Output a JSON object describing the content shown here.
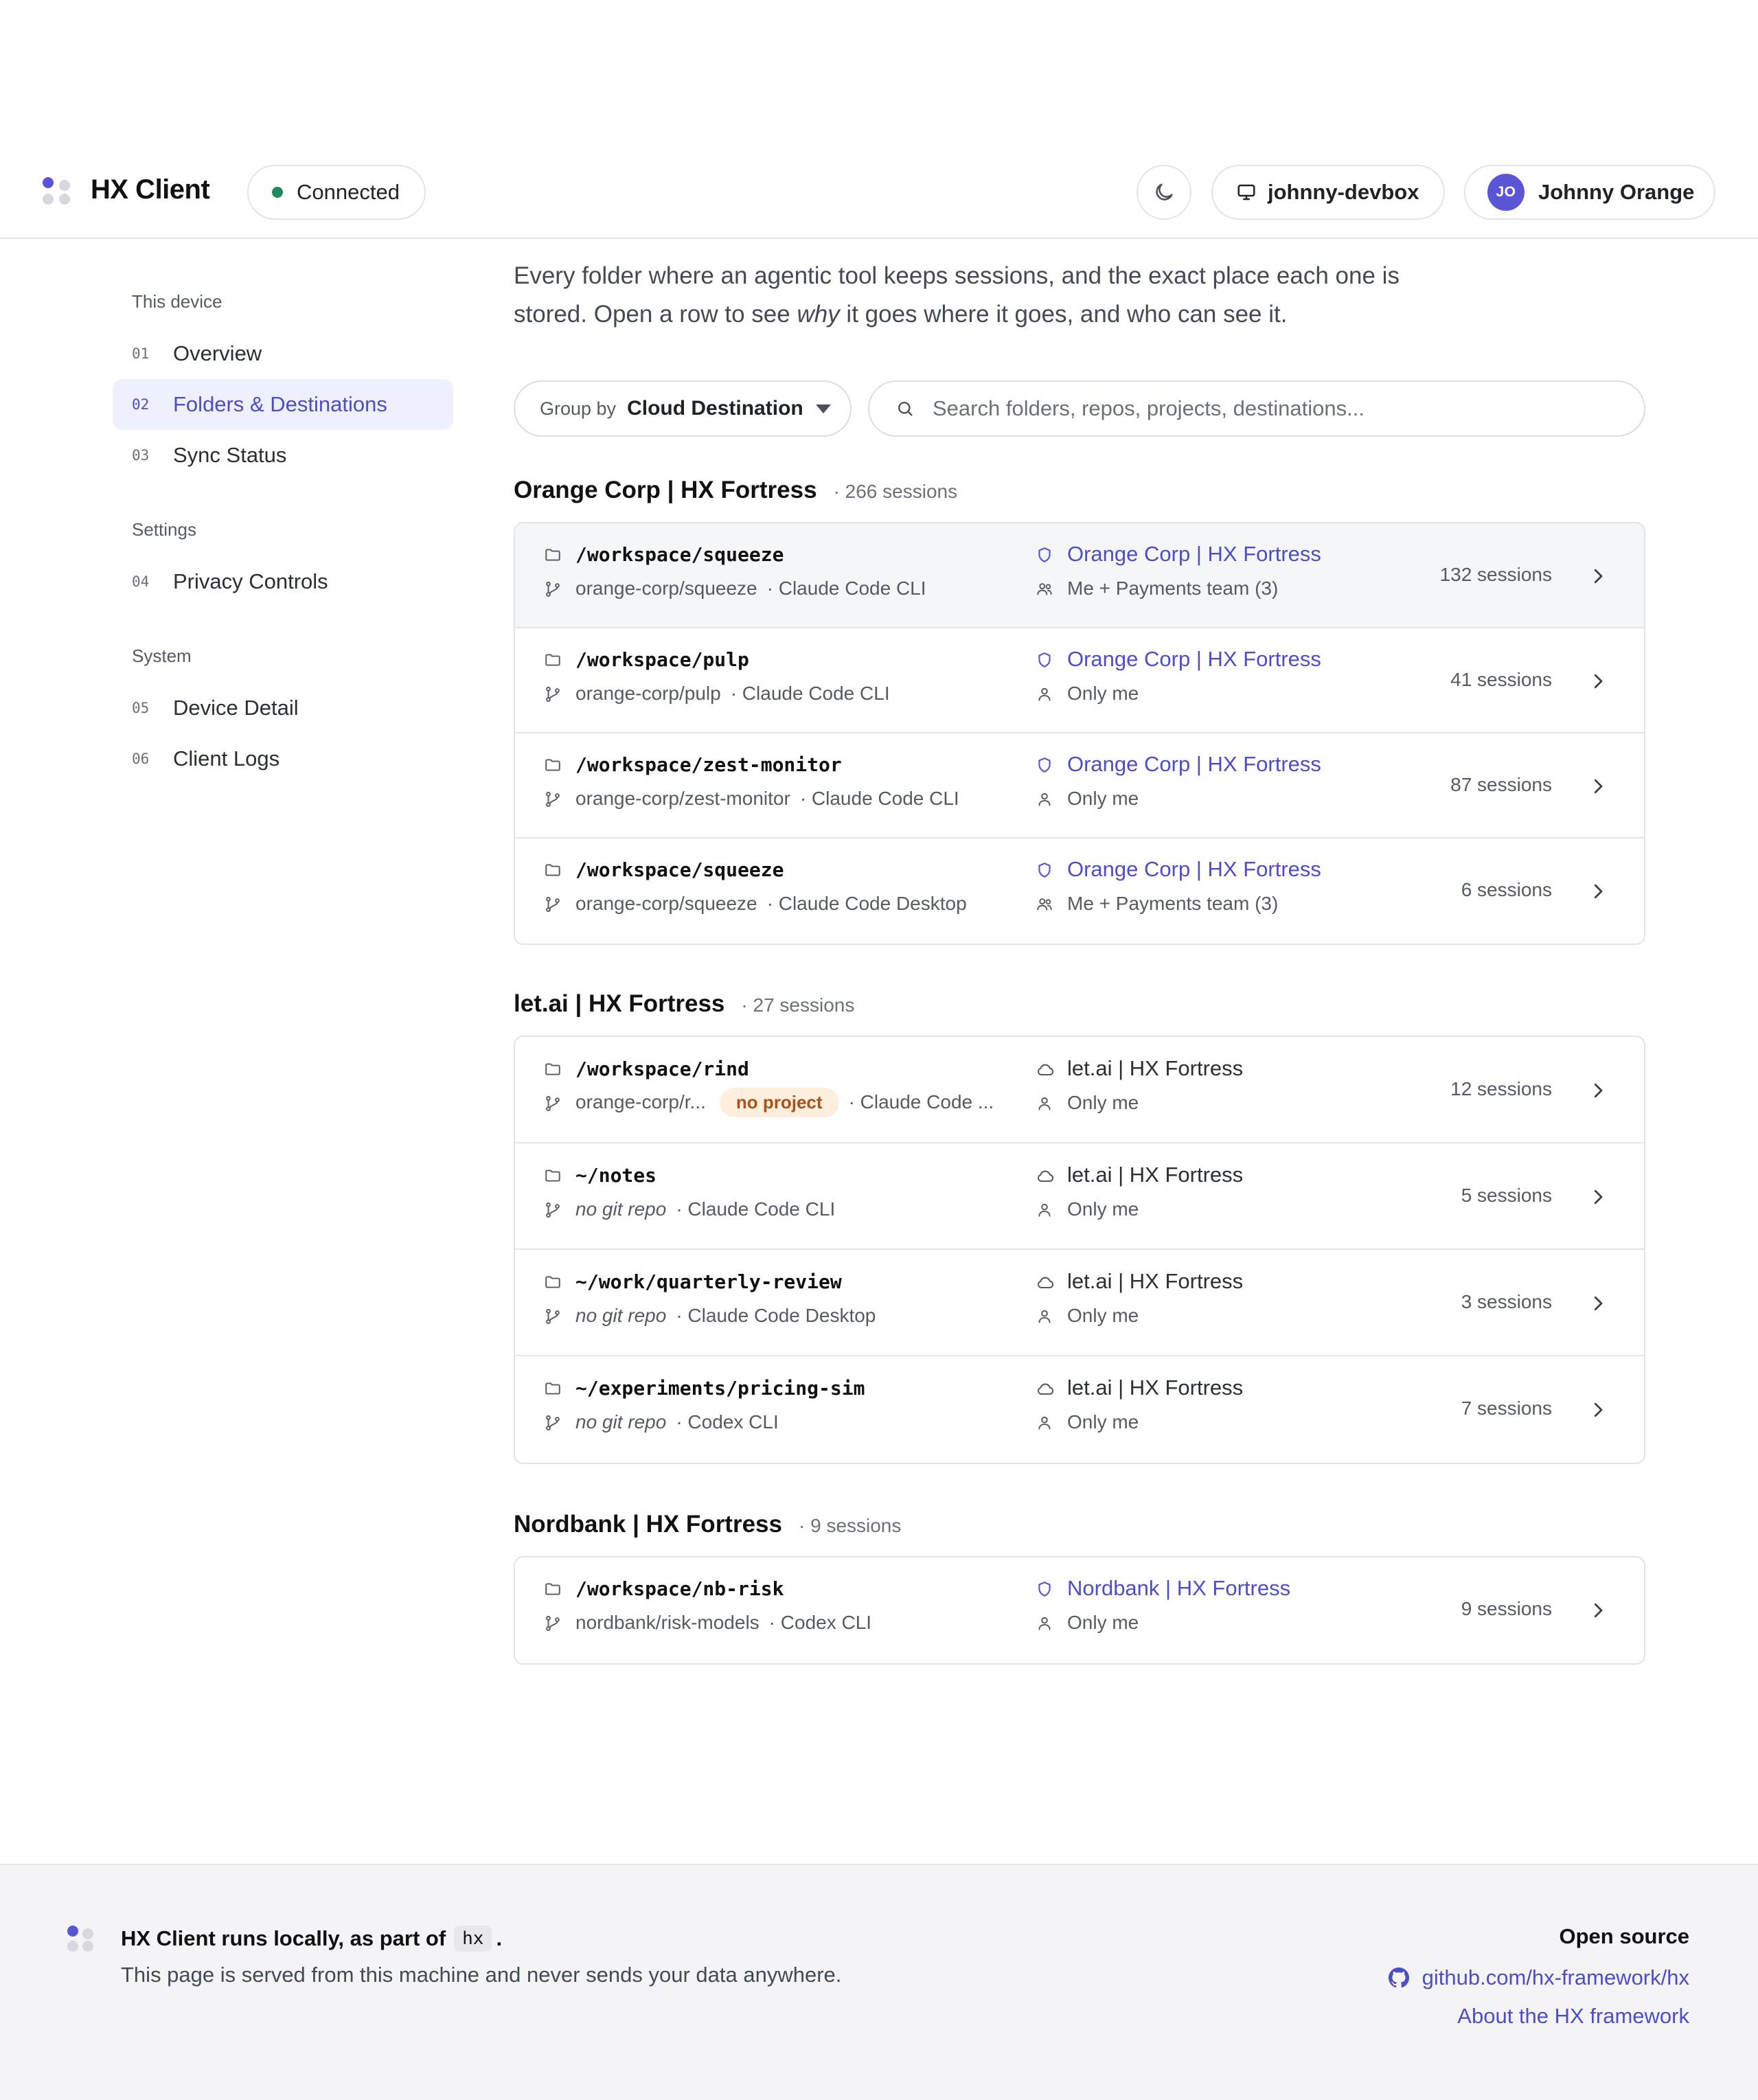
{
  "app": {
    "title": "HX Client",
    "status": "Connected",
    "device": "johnny-devbox",
    "user": {
      "initials": "JO",
      "name": "Johnny Orange"
    }
  },
  "colors": {
    "accent": "#5a55d6",
    "status_green": "#1f8a5b",
    "badge_bg": "#fdeedd",
    "badge_text": "#a8531b"
  },
  "sidebar": {
    "sections": [
      {
        "title": "This device",
        "items": [
          {
            "num": "01",
            "label": "Overview"
          },
          {
            "num": "02",
            "label": "Folders & Destinations",
            "active": true
          },
          {
            "num": "03",
            "label": "Sync Status"
          }
        ]
      },
      {
        "title": "Settings",
        "items": [
          {
            "num": "04",
            "label": "Privacy Controls"
          }
        ]
      },
      {
        "title": "System",
        "items": [
          {
            "num": "05",
            "label": "Device Detail"
          },
          {
            "num": "06",
            "label": "Client Logs"
          }
        ]
      }
    ]
  },
  "main": {
    "intro_a": "Every folder where an agentic tool keeps sessions, and the exact place each one is stored. Open a row to see ",
    "intro_em": "why",
    "intro_b": " it goes where it goes, and who can see it.",
    "groupby_label": "Group by",
    "groupby_value": "Cloud Destination",
    "search_placeholder": "Search folders, repos, projects, destinations...",
    "groups": [
      {
        "title": "Orange Corp | HX Fortress",
        "count": "· 266 sessions",
        "rows": [
          {
            "path": "/workspace/squeeze",
            "repo": "orange-corp/squeeze",
            "tool": "· Claude Code CLI",
            "dest_a": "Orange Corp",
            "dest_bar": "|",
            "dest_b": "HX Fortress",
            "visibility": "Me + Payments team (3)",
            "sessions": "132 sessions"
          },
          {
            "path": "/workspace/pulp",
            "repo": "orange-corp/pulp",
            "tool": "· Claude Code CLI",
            "dest_a": "Orange Corp",
            "dest_bar": "|",
            "dest_b": "HX Fortress",
            "visibility": "Only me",
            "sessions": "41 sessions"
          },
          {
            "path": "/workspace/zest-monitor",
            "repo": "orange-corp/zest-monitor",
            "tool": "· Claude Code CLI",
            "dest_a": "Orange Corp",
            "dest_bar": "|",
            "dest_b": "HX Fortress",
            "visibility": "Only me",
            "sessions": "87 sessions"
          },
          {
            "path": "/workspace/squeeze",
            "repo": "orange-corp/squeeze",
            "tool": "· Claude Code Desktop",
            "dest_a": "Orange Corp",
            "dest_bar": "|",
            "dest_b": "HX Fortress",
            "visibility": "Me + Payments team (3)",
            "sessions": "6 sessions"
          }
        ]
      },
      {
        "title": "let.ai | HX Fortress",
        "count": "· 27 sessions",
        "rows": [
          {
            "path": "/workspace/rind",
            "repo": "orange-corp/r...",
            "badge": "no project",
            "tool": "· Claude Code ...",
            "dest_a": "let.ai",
            "dest_bar": "|",
            "dest_b": "HX Fortress",
            "visibility": "Only me",
            "sessions": "12 sessions"
          },
          {
            "path": "~/notes",
            "repo": "no git repo",
            "tool": "· Claude Code CLI",
            "dest_a": "let.ai",
            "dest_bar": "|",
            "dest_b": "HX Fortress",
            "visibility": "Only me",
            "sessions": "5 sessions"
          },
          {
            "path": "~/work/quarterly-review",
            "repo": "no git repo",
            "tool": "· Claude Code Desktop",
            "dest_a": "let.ai",
            "dest_bar": "|",
            "dest_b": "HX Fortress",
            "visibility": "Only me",
            "sessions": "3 sessions"
          },
          {
            "path": "~/experiments/pricing-sim",
            "repo": "no git repo",
            "tool": "· Codex CLI",
            "dest_a": "let.ai",
            "dest_bar": "|",
            "dest_b": "HX Fortress",
            "visibility": "Only me",
            "sessions": "7 sessions"
          }
        ]
      },
      {
        "title": "Nordbank | HX Fortress",
        "count": "· 9 sessions",
        "rows": [
          {
            "path": "/workspace/nb-risk",
            "repo": "nordbank/risk-models",
            "tool": "· Codex CLI",
            "dest_a": "Nordbank",
            "dest_bar": "|",
            "dest_b": "HX Fortress",
            "visibility": "Only me",
            "sessions": "9 sessions"
          }
        ]
      }
    ]
  },
  "footer": {
    "title_a": "HX Client runs locally, as part of",
    "title_code": "hx",
    "title_b": ".",
    "subtitle": "This page is served from this machine and never sends your data anywhere.",
    "open_source": "Open source",
    "github_link": "github.com/hx-framework/hx",
    "about_link": "About the HX framework"
  }
}
